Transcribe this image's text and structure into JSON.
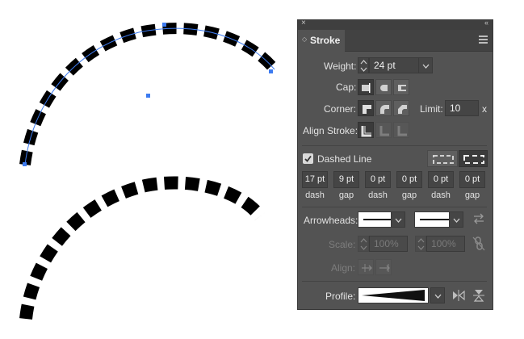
{
  "panel": {
    "tab_title": "Stroke",
    "weight": {
      "label": "Weight:",
      "value": "24 pt"
    },
    "cap": {
      "label": "Cap:"
    },
    "corner": {
      "label": "Corner:",
      "limit_label": "Limit:",
      "limit_value": "10",
      "limit_suffix": "x"
    },
    "align_stroke": {
      "label": "Align Stroke:"
    },
    "dashed_line": {
      "label": "Dashed Line",
      "checked": true
    },
    "dashes": [
      {
        "value": "17 pt",
        "label": "dash"
      },
      {
        "value": "9 pt",
        "label": "gap"
      },
      {
        "value": "0 pt",
        "label": "dash"
      },
      {
        "value": "0 pt",
        "label": "gap"
      },
      {
        "value": "0 pt",
        "label": "dash"
      },
      {
        "value": "0 pt",
        "label": "gap"
      }
    ],
    "arrowheads": {
      "label": "Arrowheads:"
    },
    "scale": {
      "label": "Scale:",
      "start": "100%",
      "end": "100%"
    },
    "align": {
      "label": "Align:"
    },
    "profile": {
      "label": "Profile:"
    }
  },
  "colors": {
    "panel_bg": "#535353",
    "selection_blue": "#3d7bf0",
    "stroke_black": "#000000"
  }
}
